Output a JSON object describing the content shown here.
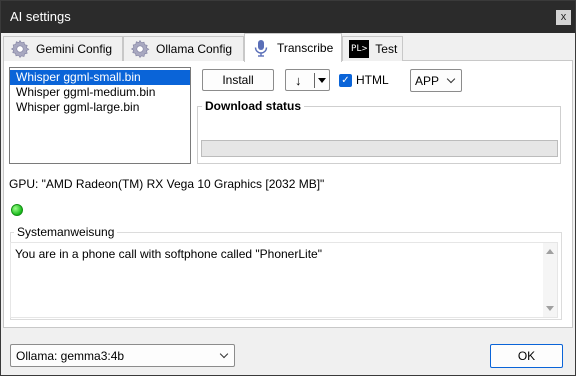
{
  "window": {
    "title": "AI settings",
    "close_glyph": "x"
  },
  "tabs": [
    {
      "label": "Gemini Config",
      "icon": "gear-icon",
      "active": false
    },
    {
      "label": "Ollama Config",
      "icon": "gear-icon",
      "active": false
    },
    {
      "label": "Transcribe",
      "icon": "microphone-icon",
      "active": true
    },
    {
      "label": "Test",
      "icon": "pl-terminal-icon",
      "icon_text": "PL>",
      "active": false
    }
  ],
  "models": {
    "items": [
      "Whisper ggml-small.bin",
      "Whisper ggml-medium.bin",
      "Whisper ggml-large.bin"
    ],
    "selected_index": 0
  },
  "toolbar": {
    "install_label": "Install",
    "download_arrow": "↓",
    "html_label": "HTML",
    "html_checked": true,
    "mode_value": "APP"
  },
  "download": {
    "label": "Download status",
    "progress_fraction": 0.0
  },
  "gpu_text": "GPU: \"AMD Radeon(TM) RX Vega 10 Graphics [2032 MB]\"",
  "status_color": "#16b91a",
  "system_prompt": {
    "label": "Systemanweisung",
    "text": "You are in a phone call with softphone called \"PhonerLite\""
  },
  "footer": {
    "model_value": "Ollama: gemma3:4b",
    "ok_label": "OK"
  },
  "colors": {
    "accent": "#0a64d8",
    "titlebar": "#2b2b2b"
  }
}
